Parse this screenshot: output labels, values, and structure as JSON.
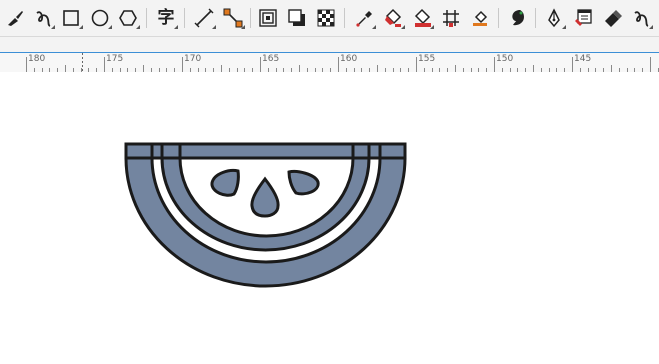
{
  "toolbar": {
    "text_tool_glyph": "字",
    "tools": [
      "artistic-media-tool",
      "bezier-curve-tool",
      "rectangle-tool",
      "ellipse-tool",
      "polygon-tool",
      "text-tool",
      "parallel-dimension-tool",
      "connector-tool",
      "contour-tool",
      "drop-shadow-tool",
      "transparency-tool",
      "eyedropper-tool",
      "interactive-fill-tool",
      "smart-fill-tool",
      "mesh-fill-tool",
      "fill-tool",
      "color-style-tool",
      "pen-tool",
      "object-properties-tool",
      "eraser-tool",
      "curve-tool"
    ]
  },
  "ruler": {
    "labels": [
      "180",
      "175",
      "170",
      "165",
      "160",
      "155",
      "150",
      "145"
    ]
  },
  "artwork": {
    "description_colors": {
      "fill": "#7385a0",
      "stroke": "#1a1a1a",
      "background": "#ffffff"
    }
  },
  "colors": {
    "ruler_top_line": "#3c8fd6",
    "toolbar_bg": "#f3f3f3"
  }
}
